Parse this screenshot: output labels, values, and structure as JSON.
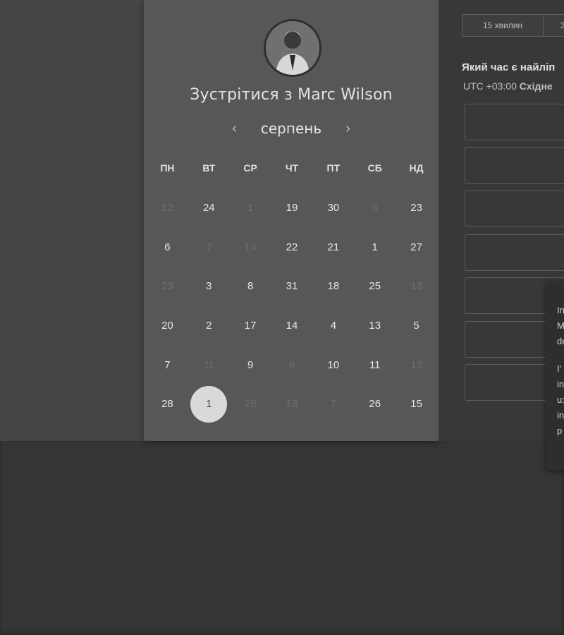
{
  "header": {
    "title": "Зустрітися з Marc Wilson"
  },
  "calendar": {
    "month": "серпень",
    "prev_arrow": "‹",
    "next_arrow": "›",
    "weekdays": [
      "ПН",
      "ВТ",
      "СР",
      "ЧТ",
      "ПТ",
      "СБ",
      "НД"
    ],
    "rows": [
      [
        {
          "d": "12",
          "disabled": true
        },
        {
          "d": "24"
        },
        {
          "d": "1",
          "disabled": true
        },
        {
          "d": "19"
        },
        {
          "d": "30"
        },
        {
          "d": "6",
          "disabled": true
        },
        {
          "d": "23"
        }
      ],
      [
        {
          "d": "6"
        },
        {
          "d": "7",
          "disabled": true
        },
        {
          "d": "14",
          "disabled": true
        },
        {
          "d": "22"
        },
        {
          "d": "21"
        },
        {
          "d": "1"
        },
        {
          "d": "27"
        }
      ],
      [
        {
          "d": "23",
          "disabled": true
        },
        {
          "d": "3"
        },
        {
          "d": "8"
        },
        {
          "d": "31"
        },
        {
          "d": "18"
        },
        {
          "d": "25"
        },
        {
          "d": "13",
          "disabled": true
        }
      ],
      [
        {
          "d": "20"
        },
        {
          "d": "2"
        },
        {
          "d": "17"
        },
        {
          "d": "14"
        },
        {
          "d": "4"
        },
        {
          "d": "13"
        },
        {
          "d": "5"
        }
      ],
      [
        {
          "d": "7"
        },
        {
          "d": "11",
          "disabled": true
        },
        {
          "d": "9"
        },
        {
          "d": "9",
          "disabled": true
        },
        {
          "d": "10"
        },
        {
          "d": "11"
        },
        {
          "d": "13",
          "disabled": true
        }
      ],
      [
        {
          "d": "28"
        },
        {
          "d": "1",
          "selected": true
        },
        {
          "d": "28",
          "disabled": true
        },
        {
          "d": "18",
          "disabled": true
        },
        {
          "d": "7",
          "disabled": true
        },
        {
          "d": "26"
        },
        {
          "d": "15"
        }
      ]
    ]
  },
  "scheduler": {
    "durations": [
      "15 хвилин",
      "3"
    ],
    "question": "Який час є найліп",
    "timezone_offset": "UTC +03:00",
    "timezone_name": "Східне",
    "slot_count": 7
  },
  "tooltip": {
    "lines": [
      "In",
      "M",
      "de",
      "I'",
      "in",
      "u:",
      "in",
      "p"
    ]
  },
  "icons": {
    "avatar": "avatar-photo",
    "prev": "chevron-left-icon",
    "next": "chevron-right-icon"
  }
}
